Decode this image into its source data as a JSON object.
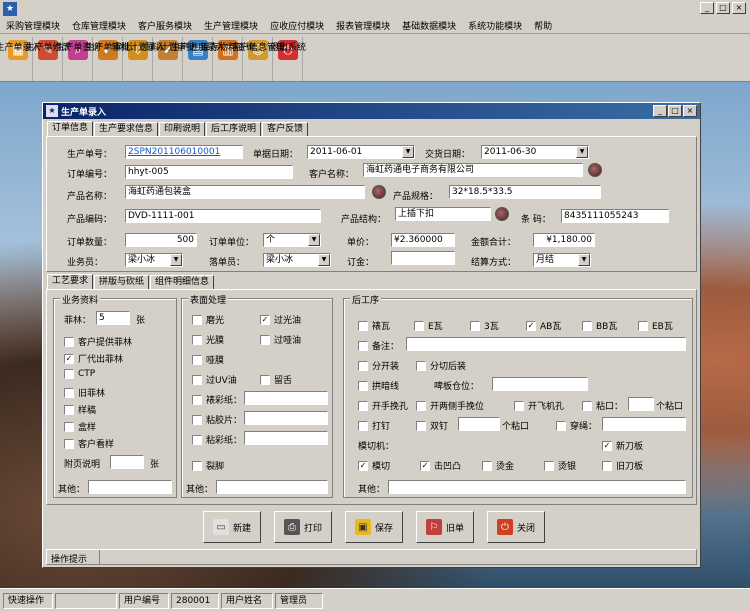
{
  "menu": [
    "采购管理模块",
    "仓库管理模块",
    "客户服务模块",
    "生产管理模块",
    "应收应付模块",
    "报表管理模块",
    "基础数据模块",
    "系统功能模块",
    "帮助"
  ],
  "toolbar": [
    {
      "label": "生产单录入",
      "icon": "order-entry-icon",
      "color": "#e89a2a"
    },
    {
      "label": "生产单修改",
      "icon": "order-edit-icon",
      "color": "#d04a30"
    },
    {
      "label": "生产单查询",
      "icon": "order-query-icon",
      "color": "#c04090"
    },
    {
      "label": "生产单审批",
      "icon": "order-approve-icon",
      "color": "#d07a20"
    },
    {
      "label": "领料计划录入",
      "icon": "material-plan-entry-icon",
      "color": "#d09020"
    },
    {
      "label": "领料计划审批",
      "icon": "material-plan-approve-icon",
      "color": "#c08030"
    },
    {
      "label": "生产进度录入",
      "icon": "progress-entry-icon",
      "color": "#3a80c0"
    },
    {
      "label": "库存物料查询",
      "icon": "inventory-query-icon",
      "color": "#d07020"
    },
    {
      "label": "客户信息管理",
      "icon": "customer-info-icon",
      "color": "#d09a30"
    },
    {
      "label": "退出系统",
      "icon": "exit-icon",
      "color": "#d03030"
    }
  ],
  "dialog": {
    "title": "生产单录入",
    "tabs": [
      "订单信息",
      "生产要求信息",
      "印刷说明",
      "后工序说明",
      "客户反馈"
    ],
    "fields": {
      "order_no_label": "生产单号：",
      "order_no": "2SPN201106010001",
      "order_date_label": "单据日期：",
      "order_date": "2011-06-01",
      "delivery_date_label": "交货日期：",
      "delivery_date": "2011-06-30",
      "order_code_label": "订单编号：",
      "order_code": "hhyt-005",
      "customer_label": "客户名称：",
      "customer": "海虹药通电子商务有限公司",
      "product_label": "产品名称：",
      "product": "海虹药通包装盒",
      "spec_label": "产品规格：",
      "spec": "32*18.5*33.5",
      "product_code_label": "产品编码：",
      "product_code": "DVD-1111-001",
      "structure_label": "产品结构：",
      "structure": "上插下扣",
      "barcode_label": "条 码：",
      "barcode": "8435111055243",
      "qty_label": "订单数量：",
      "qty": "500",
      "unit_label": "订单单位：",
      "unit": "个",
      "price_label": "单价：",
      "price": "¥2.360000",
      "total_label": "金额合计：",
      "total": "¥1,180.00",
      "sales_label": "业务员：",
      "sales": "梁小冰",
      "clerk_label": "落单员：",
      "clerk": "梁小冰",
      "deposit_label": "订金：",
      "deposit": "",
      "settle_label": "结算方式：",
      "settle": "月结"
    },
    "subtabs": [
      "工艺要求",
      "拼版与砍纸",
      "组件明细信息"
    ],
    "business": {
      "title": "业务资料",
      "sheets_label": "菲林：",
      "sheets": "5",
      "sheets_unit": "张",
      "items": [
        {
          "label": "客户提供菲林",
          "checked": false
        },
        {
          "label": "厂代出菲林",
          "checked": true
        },
        {
          "label": "CTP",
          "checked": false
        },
        {
          "label": "旧菲林",
          "checked": false
        },
        {
          "label": "样稿",
          "checked": false
        },
        {
          "label": "盒样",
          "checked": false
        },
        {
          "label": "客户看样",
          "checked": false
        }
      ],
      "attach_label": "附页说明",
      "attach_unit": "张",
      "other_label": "其他："
    },
    "surface": {
      "title": "表面处理",
      "items": [
        {
          "label": "磨光",
          "checked": false
        },
        {
          "label": "过光油",
          "checked": true
        },
        {
          "label": "光膜",
          "checked": false
        },
        {
          "label": "过哑油",
          "checked": false
        },
        {
          "label": "哑膜",
          "checked": false
        },
        {
          "label": "过UV油",
          "checked": false
        },
        {
          "label": "留舌",
          "checked": false
        },
        {
          "label": "裱彩纸：",
          "checked": false
        },
        {
          "label": "粘胶片：",
          "checked": false
        },
        {
          "label": "粘彩纸：",
          "checked": false
        },
        {
          "label": "裂脚",
          "checked": false
        }
      ],
      "other_label": "其他："
    },
    "post": {
      "title": "后工序",
      "row1": [
        {
          "label": "裱瓦",
          "checked": false
        },
        {
          "label": "E瓦",
          "checked": false
        },
        {
          "label": "3瓦",
          "checked": false
        },
        {
          "label": "AB瓦",
          "checked": true
        },
        {
          "label": "BB瓦",
          "checked": false
        },
        {
          "label": "EB瓦",
          "checked": false
        }
      ],
      "note_label": "备注：",
      "split_label": "分开装",
      "split_after_label": "分切后装",
      "crease_label": "拱暗线",
      "board_label": "啤板仓位：",
      "handhole_label": "开手挽孔",
      "two_hole_label": "开两侧手挽位",
      "plane_hole_label": "开飞机孔",
      "glue_label": "粘口：",
      "glue_unit": "个粘口",
      "nail_label": "打钉",
      "double_nail_label": "双钉",
      "double_unit": "个粘口",
      "punch_label": "穿绳：",
      "die_label": "模切机：",
      "new_die_label": "新刀板",
      "new_die_checked": true,
      "old_die_label": "旧刀板",
      "row_die": [
        {
          "label": "模切",
          "checked": true
        },
        {
          "label": "击凹凸",
          "checked": true
        },
        {
          "label": "烫金",
          "checked": false
        },
        {
          "label": "烫银",
          "checked": false
        }
      ],
      "other_label": "其他："
    },
    "buttons": [
      {
        "label": "新建",
        "icon": "new-icon",
        "color": "#e0e0e0",
        "fg": "#333"
      },
      {
        "label": "打印",
        "icon": "print-icon",
        "color": "#555",
        "fg": "#fff"
      },
      {
        "label": "保存",
        "icon": "save-icon",
        "color": "#e8b820",
        "fg": "#333"
      },
      {
        "label": "旧单",
        "icon": "old-order-icon",
        "color": "#c04040",
        "fg": "#fff"
      },
      {
        "label": "关闭",
        "icon": "close-icon",
        "color": "#d04020",
        "fg": "#fff"
      }
    ],
    "hint_label": "操作提示"
  },
  "status": {
    "quick_label": "快速操作",
    "user_code_label": "用户编号",
    "user_code": "280001",
    "user_name_label": "用户姓名",
    "user_name": "管理员"
  }
}
